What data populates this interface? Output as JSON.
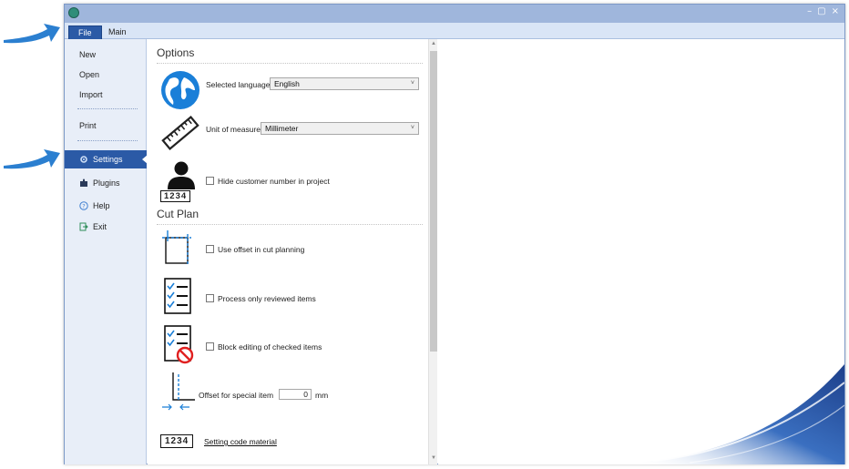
{
  "ribbon": {
    "tabs": [
      {
        "label": "File",
        "active": true
      },
      {
        "label": "Main",
        "active": false
      }
    ]
  },
  "window_controls": {
    "minimize": "–",
    "maximize": "▢",
    "close": "×"
  },
  "menu": {
    "items": [
      {
        "label": "New"
      },
      {
        "label": "Open"
      },
      {
        "label": "Import"
      },
      {
        "label": "Print"
      },
      {
        "label": "Settings",
        "active": true,
        "icon": "gear-icon"
      },
      {
        "label": "Plugins",
        "icon": "puzzle-icon"
      },
      {
        "label": "Help",
        "icon": "help-icon"
      },
      {
        "label": "Exit",
        "icon": "exit-icon"
      }
    ]
  },
  "options": {
    "title": "Options",
    "language_label": "Selected language:",
    "language_value": "English",
    "unit_label": "Unit of measure:",
    "unit_value": "Millimeter",
    "hide_customer_label": "Hide customer number in project",
    "hide_customer_checked": false,
    "customer_badge": "1234"
  },
  "cut_plan": {
    "title": "Cut Plan",
    "use_offset_label": "Use offset in cut planning",
    "use_offset_checked": false,
    "process_reviewed_label": "Process only reviewed items",
    "process_reviewed_checked": false,
    "block_editing_label": "Block editing of checked items",
    "block_editing_checked": false,
    "offset_special_label": "Offset for special item",
    "offset_special_value": "0",
    "offset_special_unit": "mm",
    "code_material_badge": "1234",
    "code_material_link": "Setting code material"
  },
  "colors": {
    "accent": "#2b5aa6",
    "titlebar": "#9fb6dc",
    "menu_bg": "#e8eef8",
    "callout_arrow": "#2b7fd0"
  }
}
